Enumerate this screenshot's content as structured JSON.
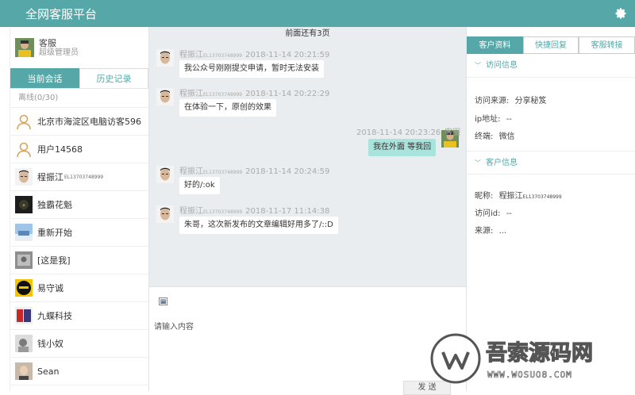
{
  "app": {
    "title": "全网客服平台"
  },
  "me": {
    "name": "客服",
    "role": "超级管理员"
  },
  "left_tabs": [
    "当前会话",
    "历史记录"
  ],
  "offline_label": "离线(0/30)",
  "contacts": [
    {
      "name": "北京市海淀区电脑访客596",
      "tag": "",
      "avatar": "person-outline"
    },
    {
      "name": "用户14568",
      "tag": "",
      "avatar": "person-outline"
    },
    {
      "name": "程振江",
      "tag": "EL13703748999",
      "avatar": "photo-man"
    },
    {
      "name": "独霸花魁",
      "tag": "",
      "avatar": "photo-dark"
    },
    {
      "name": "重新开始",
      "tag": "",
      "avatar": "photo-sky"
    },
    {
      "name": "[这是我]",
      "tag": "",
      "avatar": "photo-grey"
    },
    {
      "name": "易守诚",
      "tag": "",
      "avatar": "photo-yellow"
    },
    {
      "name": "九蝶科技",
      "tag": "",
      "avatar": "photo-red"
    },
    {
      "name": "钱小奴",
      "tag": "",
      "avatar": "photo-pale"
    },
    {
      "name": "Sean",
      "tag": "",
      "avatar": "photo-face"
    }
  ],
  "chat": {
    "more_label": "前面还有3页",
    "messages": [
      {
        "side": "left",
        "sender": "程振江",
        "sender_tag": "EL13703748999",
        "time": "2018-11-14 20:21:59",
        "text": "我公众号刚刚提交申请，暂时无法安装"
      },
      {
        "side": "left",
        "sender": "程振江",
        "sender_tag": "EL13703748999",
        "time": "2018-11-14 20:22:29",
        "text": "在体验一下，原创的效果"
      },
      {
        "side": "right",
        "sender": "客服",
        "sender_tag": "",
        "time": "2018-11-14 20:23:26",
        "text": "我在外面 等我回"
      },
      {
        "side": "left",
        "sender": "程振江",
        "sender_tag": "EL13703748999",
        "time": "2018-11-14 20:24:59",
        "text": "好的/:ok"
      },
      {
        "side": "left",
        "sender": "程振江",
        "sender_tag": "EL13703748999",
        "time": "2018-11-17 11:14:38",
        "text": "朱哥，这次新发布的文章编辑好用多了/::D"
      }
    ]
  },
  "composer": {
    "placeholder": "请输入内容",
    "send_label": "发 送"
  },
  "right_tabs": [
    "客户资料",
    "快捷回复",
    "客服转接"
  ],
  "visit_section": {
    "title": "访问信息",
    "fields": [
      {
        "label": "访问来源:",
        "value": "分享秘笈"
      },
      {
        "label": "ip地址:",
        "value": "--"
      },
      {
        "label": "终端:",
        "value": "微信"
      }
    ]
  },
  "customer_section": {
    "title": "客户信息",
    "fields": [
      {
        "label": "昵称:",
        "value": "程振江",
        "tag": "EL13703748999"
      },
      {
        "label": "访问id:",
        "value": "--"
      },
      {
        "label": "来源:",
        "value": "..."
      }
    ]
  },
  "watermark": {
    "main": "吾索源码网",
    "url": "WWW.WOSUO8.COM"
  },
  "colors": {
    "accent": "#56a8a8",
    "chat_bg": "#eaedf0",
    "mine_bubble": "#a8e3dc"
  }
}
